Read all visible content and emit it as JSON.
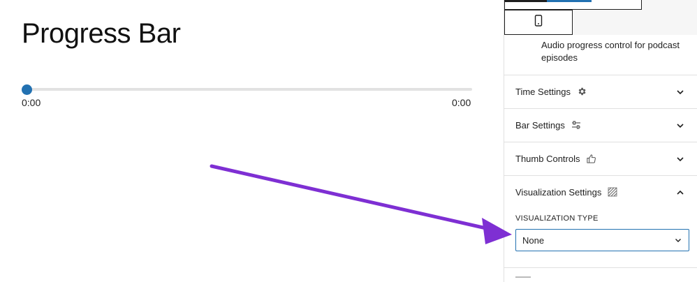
{
  "canvas": {
    "title": "Progress Bar",
    "progress": {
      "value": 0,
      "time_start": "0:00",
      "time_end": "0:00"
    }
  },
  "sidebar": {
    "device_icon": "mobile-device-icon",
    "block_description": "Audio progress control for podcast episodes",
    "panels": [
      {
        "label": "Time Settings",
        "icon": "gear-icon",
        "expanded": false
      },
      {
        "label": "Bar Settings",
        "icon": "sliders-icon",
        "expanded": false
      },
      {
        "label": "Thumb Controls",
        "icon": "thumbs-up-icon",
        "expanded": false
      },
      {
        "label": "Visualization Settings",
        "icon": "pattern-icon",
        "expanded": true
      }
    ],
    "visualization": {
      "type_label": "VISUALIZATION TYPE",
      "type_value": "None"
    }
  },
  "colors": {
    "accent": "#2271b1",
    "annotation_arrow": "#7e2fd3"
  }
}
